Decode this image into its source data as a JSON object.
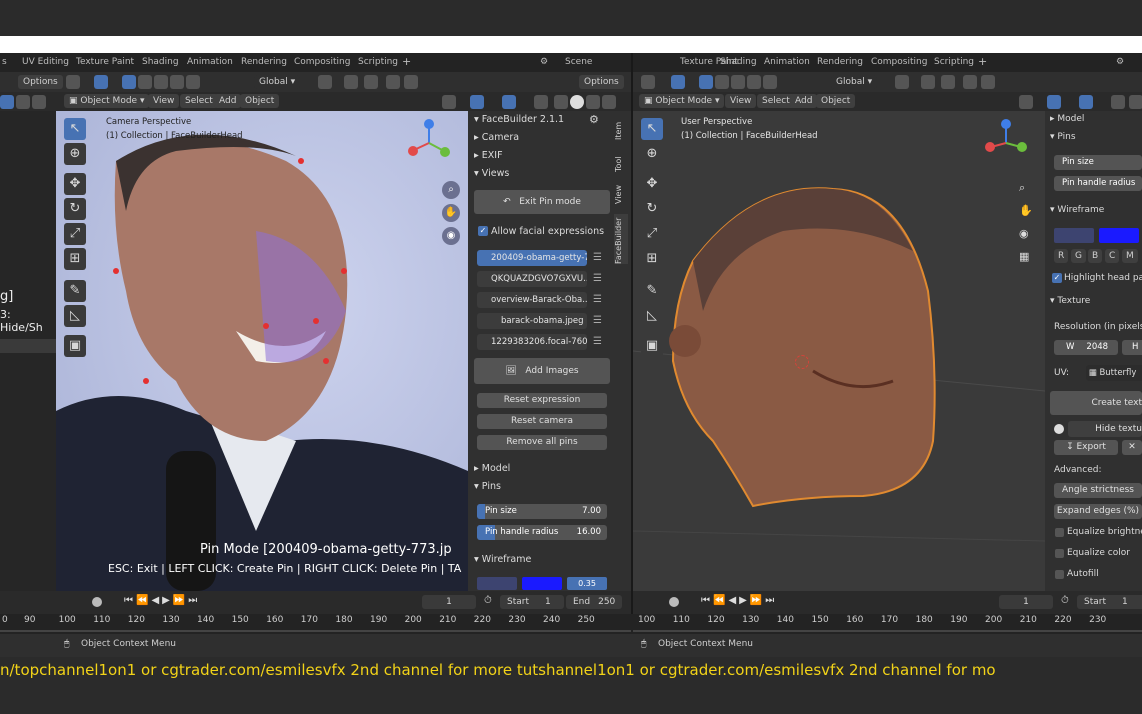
{
  "tabs": [
    "UV Editing",
    "Texture Paint",
    "Shading",
    "Animation",
    "Rendering",
    "Compositing",
    "Scripting"
  ],
  "tabs_right": [
    "Texture Paint",
    "Shading",
    "Animation",
    "Rendering",
    "Compositing",
    "Scripting"
  ],
  "scene_label": "Scene",
  "options_label": "Options",
  "global_label": "Global",
  "left_viewport": {
    "mode": "Object Mode",
    "menu": [
      "View",
      "Select",
      "Add",
      "Object"
    ],
    "overlay_line1": "Camera Perspective",
    "overlay_line2": "(1) Collection | FaceBuilderHead",
    "pin_mode_line": "Pin Mode  [200409-obama-getty-773.jp",
    "help_line": "ESC: Exit | LEFT CLICK: Create Pin | RIGHT CLICK: Delete Pin | TA",
    "left_cut_1": "g]",
    "left_cut_2": "3: Hide/Sh"
  },
  "facebuilder": {
    "title": "FaceBuilder 2.1.1",
    "camera": "Camera",
    "exif": "EXIF",
    "views": "Views",
    "exit_pin_mode": "Exit Pin mode",
    "allow_expressions": "Allow facial expressions",
    "images": [
      "200409-obama-getty-7...",
      "QKQUAZDGVO7GXVU...",
      "overview-Barack-Oba...",
      "barack-obama.jpeg",
      "1229383206.focal-760..."
    ],
    "add_images": "Add Images",
    "reset_expression": "Reset expression",
    "reset_camera": "Reset camera",
    "remove_all_pins": "Remove all pins",
    "model": "Model",
    "pins": "Pins",
    "pin_size_label": "Pin size",
    "pin_size_value": "7.00",
    "pin_radius_label": "Pin handle radius",
    "pin_radius_value": "16.00",
    "wireframe": "Wireframe",
    "wire_value": "0.35",
    "vtabs": [
      "Item",
      "Tool",
      "View",
      "FaceBuilder"
    ]
  },
  "right_viewport": {
    "mode": "Object Mode",
    "menu": [
      "View",
      "Select",
      "Add",
      "Object"
    ],
    "overlay_line1": "User Perspective",
    "overlay_line2": "(1) Collection | FaceBuilderHead"
  },
  "right_panel": {
    "model": "Model",
    "pins": "Pins",
    "pin_size": "Pin size",
    "pin_radius": "Pin handle radius",
    "wireframe": "Wireframe",
    "highlight": "Highlight head parts",
    "texture": "Texture",
    "resolution": "Resolution (in pixels):",
    "w_label": "W",
    "w_value": "2048",
    "h_label": "H",
    "uv_label": "UV:",
    "uv_value": "Butterfly",
    "create_texture": "Create text",
    "hide_texture": "Hide textu",
    "export": "Export",
    "advanced": "Advanced:",
    "angle": "Angle strictness",
    "expand": "Expand edges (%)",
    "eq_brightness": "Equalize brightness",
    "eq_color": "Equalize color",
    "autofill": "Autofill"
  },
  "timeline_left": {
    "frame": "1",
    "start_label": "Start",
    "start": "1",
    "end_label": "End",
    "end": "250",
    "ruler": [
      "0",
      "90",
      "100",
      "110",
      "120",
      "130",
      "140",
      "150",
      "160",
      "170",
      "180",
      "190",
      "200",
      "210",
      "220",
      "230",
      "240",
      "250"
    ]
  },
  "timeline_right": {
    "frame": "1",
    "start_label": "Start",
    "start": "1",
    "ruler": [
      "100",
      "110",
      "120",
      "130",
      "140",
      "150",
      "160",
      "170",
      "180",
      "190",
      "200",
      "210",
      "220",
      "230"
    ]
  },
  "status_left": "Object Context Menu",
  "status_right": "Object Context Menu",
  "ticker": "n/topchannel1on1 or cgtrader.com/esmilesvfx  2nd channel for more tutshannel1on1 or cgtrader.com/esmilesvfx  2nd channel for mo",
  "colors": {
    "accent": "#4772b3",
    "ticker": "#f2d318",
    "viewport_bg": "#b9c0de",
    "gizmo_x": "#e24a4a",
    "gizmo_y": "#6bbd3c",
    "gizmo_z": "#3f7ee8"
  }
}
